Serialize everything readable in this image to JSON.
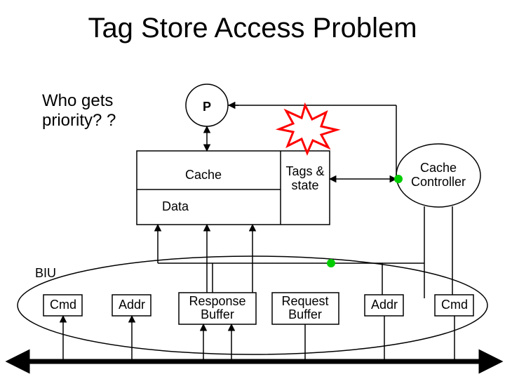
{
  "title": "Tag Store Access Problem",
  "question_line1": "Who gets",
  "question_line2": "priority? ?",
  "nodes": {
    "p": "P",
    "cache": "Cache",
    "data": "Data",
    "tags_line1": "Tags &",
    "tags_line2": "state",
    "controller_line1": "Cache",
    "controller_line2": "Controller",
    "biu": "BIU",
    "cmd_left": "Cmd",
    "addr_left": "Addr",
    "resp_buf_line1": "Response",
    "resp_buf_line2": "Buffer",
    "req_buf_line1": "Request",
    "req_buf_line2": "Buffer",
    "addr_right": "Addr",
    "cmd_right": "Cmd"
  },
  "colors": {
    "bus": "#000000",
    "conflict_stroke": "#ff0000",
    "conflict_fill": "#ffffff",
    "dot": "#00cc00"
  }
}
